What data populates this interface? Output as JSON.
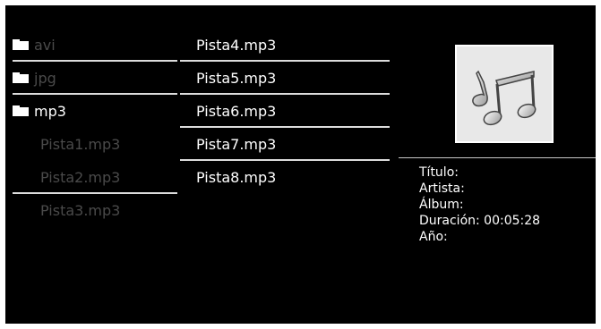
{
  "folders": [
    {
      "name": "avi",
      "state": "dim"
    },
    {
      "name": "jpg",
      "state": "dim"
    },
    {
      "name": "mp3",
      "state": "bright"
    }
  ],
  "files_left": [
    "Pista1.mp3",
    "Pista2.mp3",
    "Pista3.mp3"
  ],
  "files_right": [
    "Pista4.mp3",
    "Pista5.mp3",
    "Pista6.mp3",
    "Pista7.mp3",
    "Pista8.mp3"
  ],
  "info": {
    "title_label": "Título:",
    "artist_label": "Artista:",
    "album_label": "Álbum:",
    "duration_line": "Duración: 00:05:28",
    "year_label": "Año:"
  },
  "icons": {
    "folder": "folder-icon",
    "album_art": "music-note-icon"
  },
  "colors": {
    "background": "#000000",
    "text_active": "#ffffff",
    "text_inactive": "#4a4a4a",
    "separator": "#dcdcdc"
  }
}
